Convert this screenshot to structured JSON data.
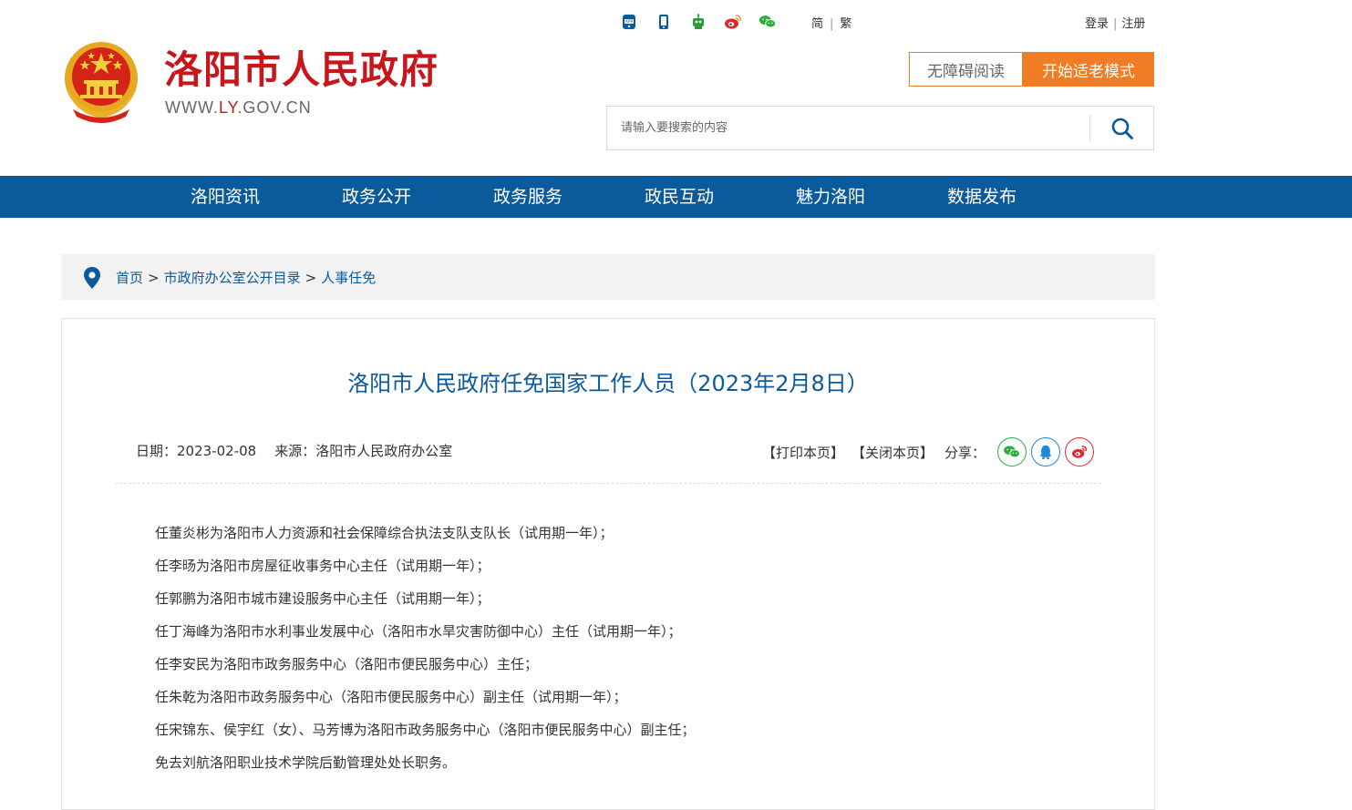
{
  "header": {
    "title": "洛阳市人民政府",
    "url_prefix": "WWW.",
    "url_highlight": "LY",
    "url_suffix": ".GOV.CN",
    "top_icons": [
      "app-icon",
      "mobile-icon",
      "robot-icon",
      "weibo-icon",
      "wechat-icon"
    ],
    "lang_simplified": "简",
    "lang_traditional": "繁",
    "login": "登录",
    "register": "注册",
    "accessibility_label": "无障碍阅读",
    "elder_mode_label": "开始适老模式",
    "search_placeholder": "请输入要搜索的内容",
    "brand_red": "#c8161d",
    "accent_orange": "#f07c26"
  },
  "nav": {
    "items": [
      "洛阳资讯",
      "政务公开",
      "政务服务",
      "政民互动",
      "魅力洛阳",
      "数据发布"
    ],
    "color": "#0b5a9c"
  },
  "breadcrumb": {
    "home": "首页",
    "level1": "市政府办公室公开目录",
    "level2": "人事任免",
    "separator": ">"
  },
  "article": {
    "title": "洛阳市人民政府任免国家工作人员（2023年2月8日）",
    "date": "日期：2023-02-08",
    "source": "来源：洛阳市人民政府办公室",
    "print": "【打印本页】",
    "close": "【关闭本页】",
    "share_label": "分享：",
    "share_icons": [
      "wechat-share-icon",
      "qq-share-icon",
      "weibo-share-icon"
    ],
    "paragraphs": [
      "任董炎彬为洛阳市人力资源和社会保障综合执法支队支队长（试用期一年）；",
      "任李旸为洛阳市房屋征收事务中心主任（试用期一年）；",
      "任郭鹏为洛阳市城市建设服务中心主任（试用期一年）；",
      "任丁海峰为洛阳市水利事业发展中心（洛阳市水旱灾害防御中心）主任（试用期一年）；",
      "任李安民为洛阳市政务服务中心（洛阳市便民服务中心）主任；",
      "任朱乾为洛阳市政务服务中心（洛阳市便民服务中心）副主任（试用期一年）；",
      "任宋锦东、侯宇红（女）、马芳博为洛阳市政务服务中心（洛阳市便民服务中心）副主任；",
      "免去刘航洛阳职业技术学院后勤管理处处长职务。"
    ]
  }
}
